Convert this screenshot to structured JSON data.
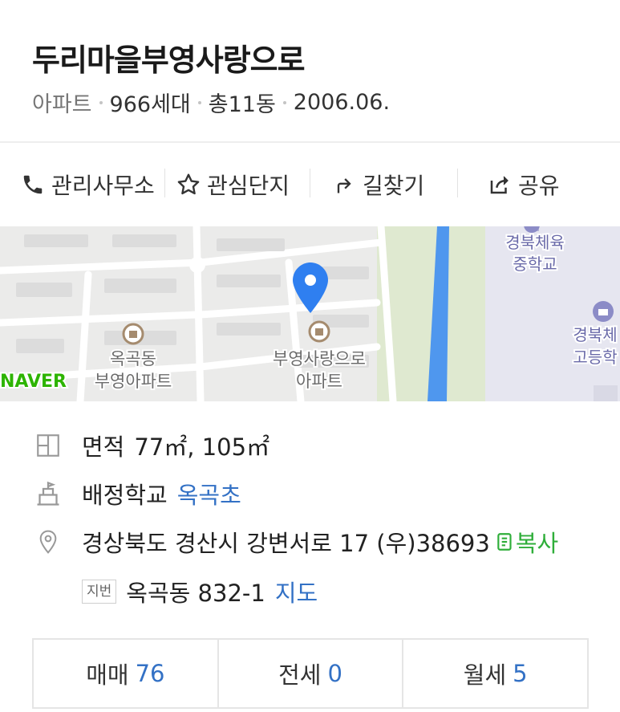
{
  "header": {
    "title": "두리마을부영사랑으로",
    "type": "아파트",
    "households": "966세대",
    "buildings": "총11동",
    "date": "2006.06."
  },
  "actions": [
    {
      "label": "관리사무소",
      "icon": "phone-icon"
    },
    {
      "label": "관심단지",
      "icon": "star-icon"
    },
    {
      "label": "길찾기",
      "icon": "directions-icon"
    },
    {
      "label": "공유",
      "icon": "share-icon"
    }
  ],
  "map": {
    "brand": "NAVER",
    "labels": {
      "school_mid_1": "경북체육",
      "school_mid_2": "중학교",
      "school_high_1": "경북체",
      "school_high_2": "고등학",
      "apt_left_1": "옥곡동",
      "apt_left_2": "부영아파트",
      "apt_center_1": "부영사랑으로",
      "apt_center_2": "아파트"
    },
    "colors": {
      "marker": "#2f7ff0",
      "water": "#4f97ee",
      "park": "#dfe9d0"
    }
  },
  "info": {
    "area_label": "면적",
    "area_value": "77㎡, 105㎡",
    "school_label": "배정학교",
    "school_value": "옥곡초",
    "address": "경상북도 경산시 강변서로 17 (우)38693",
    "copy_label": "복사",
    "jibun_badge": "지번",
    "jibun_value": "옥곡동 832-1",
    "map_link": "지도"
  },
  "tabs": [
    {
      "label": "매매",
      "count": "76"
    },
    {
      "label": "전세",
      "count": "0"
    },
    {
      "label": "월세",
      "count": "5"
    }
  ]
}
